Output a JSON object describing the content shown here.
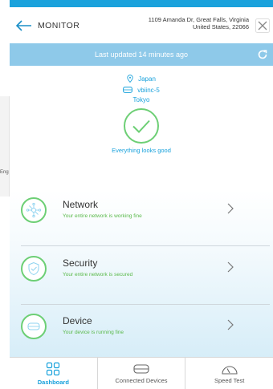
{
  "header": {
    "title": "MONITOR",
    "address_line1": "1109 Amanda Dr, Great Falls, Virginia",
    "address_line2": "United States, 22066"
  },
  "updated": {
    "text": "Last updated 14 minutes ago"
  },
  "status": {
    "country": "Japan",
    "device_name": "vbiinc-5",
    "city": "Tokyo",
    "message": "Everything looks good"
  },
  "background_window_text": "Eng",
  "panels": [
    {
      "title": "Network",
      "subtitle": "Your entire network is working fine",
      "icon": "network-icon"
    },
    {
      "title": "Security",
      "subtitle": "Your entire network is secured",
      "icon": "shield-check-icon"
    },
    {
      "title": "Device",
      "subtitle": "Your device is running fine",
      "icon": "router-icon"
    }
  ],
  "tabs": [
    {
      "label": "Dashboard",
      "icon": "dashboard-grid-icon",
      "active": true
    },
    {
      "label": "Connected Devices",
      "icon": "router-icon",
      "active": false
    },
    {
      "label": "Speed Test",
      "icon": "speedometer-icon",
      "active": false
    }
  ],
  "colors": {
    "accent": "#1aa2dc",
    "updated_bar": "#8ec9e9",
    "good_green": "#6dcf75",
    "status_text_green": "#5ab94a"
  }
}
